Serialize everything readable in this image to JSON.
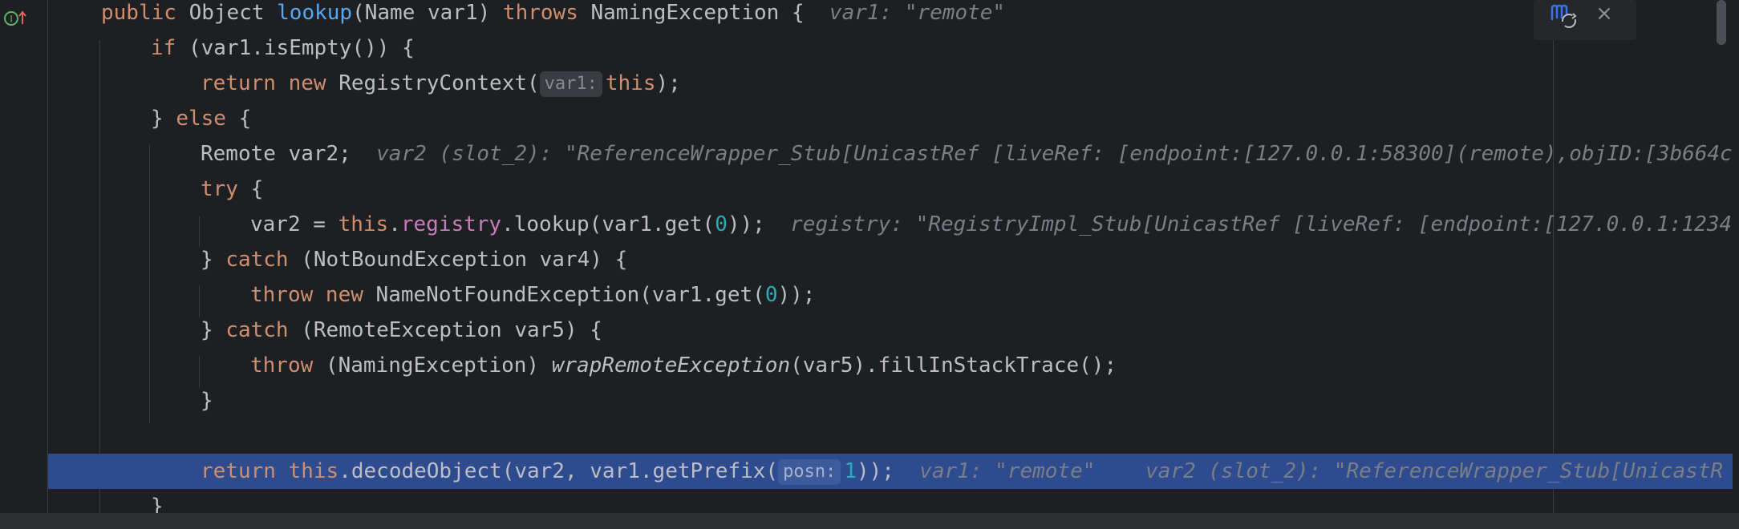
{
  "editor": {
    "language": "java",
    "gutter_icon": "implementing-method-icon",
    "lines": [
      {
        "name": "code-line-1",
        "tokens": [
          {
            "t": "public ",
            "c": "kw"
          },
          {
            "t": "Object "
          },
          {
            "t": "lookup",
            "c": "fn"
          },
          {
            "t": "(Name var1) "
          },
          {
            "t": "throws ",
            "c": "kw"
          },
          {
            "t": "NamingException {  "
          },
          {
            "t": "var1: \"remote\"",
            "c": "inlay"
          }
        ]
      },
      {
        "name": "code-line-2",
        "tokens": [
          {
            "t": "if ",
            "c": "kw"
          },
          {
            "t": "(var1.isEmpty()) {"
          }
        ]
      },
      {
        "name": "code-line-3",
        "tokens": [
          {
            "t": "return ",
            "c": "kw"
          },
          {
            "t": "new ",
            "c": "kw"
          },
          {
            "t": "RegistryContext("
          },
          {
            "t": "var1:",
            "c": "hint"
          },
          {
            "t": "this",
            "c": "kw"
          },
          {
            "t": ");"
          }
        ]
      },
      {
        "name": "code-line-4",
        "tokens": [
          {
            "t": "} "
          },
          {
            "t": "else ",
            "c": "kw"
          },
          {
            "t": "{"
          }
        ]
      },
      {
        "name": "code-line-5",
        "tokens": [
          {
            "t": "Remote var2;  "
          },
          {
            "t": "var2 (slot_2): \"ReferenceWrapper_Stub[UnicastRef [liveRef: [endpoint:[127.0.0.1:58300](remote),objID:[3b664c",
            "c": "inlay"
          }
        ]
      },
      {
        "name": "code-line-6",
        "tokens": [
          {
            "t": "try ",
            "c": "kw"
          },
          {
            "t": "{"
          }
        ]
      },
      {
        "name": "code-line-7",
        "tokens": [
          {
            "t": "var2 = "
          },
          {
            "t": "this",
            "c": "kw"
          },
          {
            "t": "."
          },
          {
            "t": "registry",
            "c": "fld"
          },
          {
            "t": ".lookup(var1.get("
          },
          {
            "t": "0",
            "c": "num"
          },
          {
            "t": "));  "
          },
          {
            "t": "registry: \"RegistryImpl_Stub[UnicastRef [liveRef: [endpoint:[127.0.0.1:1234",
            "c": "inlay"
          }
        ]
      },
      {
        "name": "code-line-8",
        "tokens": [
          {
            "t": "} "
          },
          {
            "t": "catch ",
            "c": "kw"
          },
          {
            "t": "(NotBoundException var4) {"
          }
        ]
      },
      {
        "name": "code-line-9",
        "tokens": [
          {
            "t": "throw ",
            "c": "kw"
          },
          {
            "t": "new ",
            "c": "kw"
          },
          {
            "t": "NameNotFoundException(var1.get("
          },
          {
            "t": "0",
            "c": "num"
          },
          {
            "t": "));"
          }
        ]
      },
      {
        "name": "code-line-10",
        "tokens": [
          {
            "t": "} "
          },
          {
            "t": "catch ",
            "c": "kw"
          },
          {
            "t": "(RemoteException var5) {"
          }
        ]
      },
      {
        "name": "code-line-11",
        "tokens": [
          {
            "t": "throw ",
            "c": "kw"
          },
          {
            "t": "(NamingException) "
          },
          {
            "t": "wrapRemoteException",
            "c": "it"
          },
          {
            "t": "(var5).fillInStackTrace();"
          }
        ]
      },
      {
        "name": "code-line-12",
        "tokens": [
          {
            "t": "}"
          }
        ]
      },
      {
        "name": "code-line-13",
        "tokens": []
      },
      {
        "name": "code-line-14-execution-point",
        "tokens": [
          {
            "t": "return ",
            "c": "kw"
          },
          {
            "t": "this",
            "c": "kw"
          },
          {
            "t": ".decodeObject(var2, var1.getPrefix("
          },
          {
            "t": "posn:",
            "c": "hint"
          },
          {
            "t": "1",
            "c": "num"
          },
          {
            "t": "));  "
          },
          {
            "t": "var1: \"remote\"    var2 (slot_2): \"ReferenceWrapper_Stub[UnicastR",
            "c": "inlay"
          }
        ]
      },
      {
        "name": "code-line-15",
        "tokens": [
          {
            "t": "}"
          }
        ]
      }
    ],
    "execution_line": 13,
    "floating_toolbar": {
      "sync_icon": "maven-reload-icon",
      "close_label": "×"
    }
  }
}
